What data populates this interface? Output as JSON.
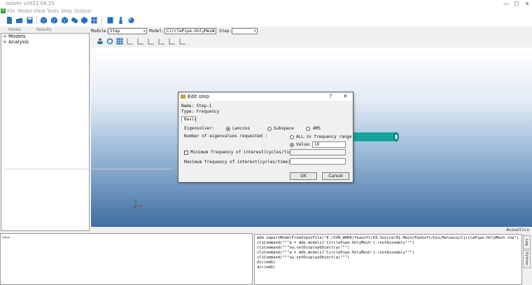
{
  "window": {
    "title": "Isolver v2021 08.25",
    "minimize": "—",
    "maximize": "☐",
    "close": "✕"
  },
  "app_badge": "IS",
  "menu": [
    "File",
    "Model",
    "View",
    "Tools",
    "Step",
    "Output"
  ],
  "left_tabs": [
    "Model",
    "Results"
  ],
  "tree": [
    {
      "expander": "+",
      "label": "Models"
    },
    {
      "expander": "+",
      "label": "Analysis"
    }
  ],
  "context_bar": {
    "module_label": "Module:",
    "module_value": "Step",
    "model_label": "Model:",
    "model_value": "CirclePipe-OnlyMesh",
    "step_label": "Step:",
    "step_value": ""
  },
  "dialog": {
    "title": "Edit step",
    "help": "?",
    "close": "✕",
    "name_line": "Name: Step-1",
    "type_line": "Type: Frequency",
    "tab": "Basic",
    "eigensolver_label": "Eigensolver:",
    "solver_options": [
      "Lanczos",
      "Subspace",
      "AMS"
    ],
    "solver_selected": "Lanczos",
    "eig_count_label": "Number of eigenvalues requested :",
    "all_in_range": "ALL in frequency range",
    "value_label": "Value:",
    "value": "10",
    "min_freq_label": "Minimum frequency of interest(cycles/time):",
    "min_freq_value": "",
    "max_freq_label": "Maximum frequency of interest(cycles/time):",
    "max_freq_value": "",
    "ok": "OK",
    "cancel": "Cancel"
  },
  "acoustics_label": "Acoustics",
  "console": {
    "prompt": ">>>"
  },
  "history": [
    "mdb.importModelFromInputFile(\"E:/SVN_WORK/feasoft/03.Source/01.Main/FeaSoft/bin/Release/CirclePipe-OnlyMesh.inp\")",
    "cliCommand(\"\"\"a = mdb.models['CirclePipe-OnlyMesh'].rootAssembly\"\"\")",
    "cliCommand(\"\"\"vw.setDisplayObject(a)\"\"\")",
    "cliCommand(\"\"\"a = mdb.models['CirclePipe-OnlyMesh'].rootAssembly\"\"\")",
    "cliCommand(\"\"\"vw.setDisplayObject(a)\"\"\")",
    "dir(mdb)",
    "dir(mdb)"
  ],
  "side_tabs": [
    "Log",
    "Python"
  ],
  "colors": {
    "toolbar_icon": "#1e6fc4",
    "mesh": "#19b7b0",
    "viewport_bottom": "#3f6ea0"
  }
}
